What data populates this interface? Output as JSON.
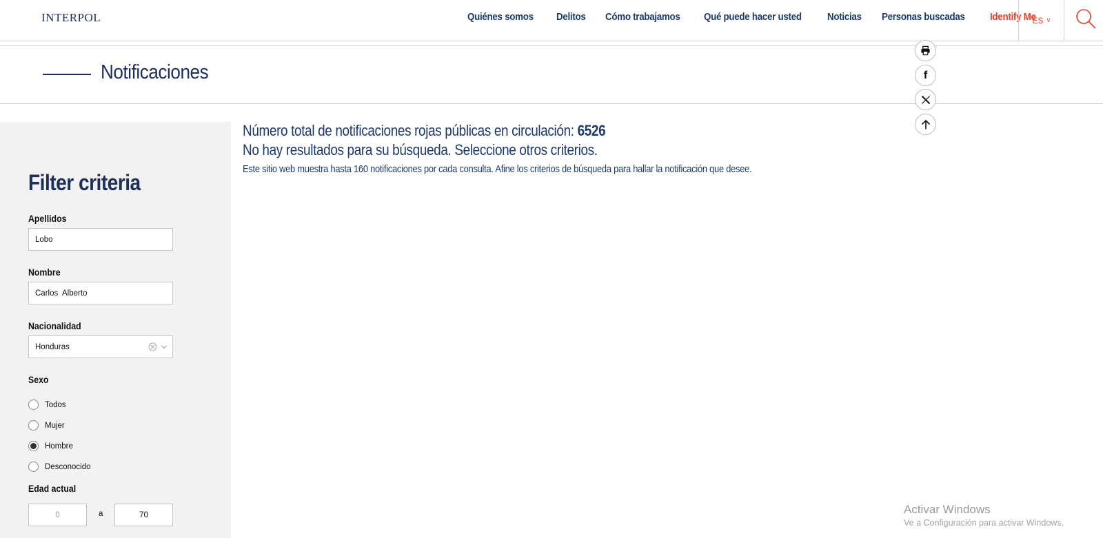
{
  "header": {
    "logo": "INTERPOL",
    "nav": [
      "Quiénes somos",
      "Delitos",
      "Cómo trabajamos",
      "Qué puede hacer usted",
      "Noticias",
      "Personas buscadas",
      "Identify Me"
    ],
    "language": "ES",
    "language_chevron": "v",
    "search_icon": "search-icon"
  },
  "page": {
    "title": "Notificaciones"
  },
  "share": {
    "icons": [
      "print-icon",
      "facebook-icon",
      "x-icon",
      "arrow-up-icon"
    ],
    "facebook_glyph": "f"
  },
  "filter": {
    "title": "Filter criteria",
    "apellidos_label": "Apellidos",
    "apellidos_value": "Lobo",
    "nombre_label": "Nombre",
    "nombre_value": "Carlos  Alberto",
    "nacionalidad_label": "Nacionalidad",
    "nacionalidad_value": "Honduras",
    "sexo_label": "Sexo",
    "sexo_options": [
      "Todos",
      "Mujer",
      "Hombre",
      "Desconocido"
    ],
    "sexo_selected": "Hombre",
    "edad_label": "Edad actual",
    "edad_min_placeholder": "0",
    "edad_separator": "a",
    "edad_max_value": "70"
  },
  "results": {
    "total_label": "Número total de notificaciones rojas públicas en circulación: ",
    "total_value": "6526",
    "no_results": "No hay resultados para su búsqueda. Seleccione otros criterios.",
    "note": "Este sitio web muestra hasta 160 notificaciones por cada consulta. Afine los criterios de búsqueda para hallar la notificación que desee."
  },
  "watermark": {
    "title": "Activar Windows",
    "subtitle": "Ve a Configuración para activar Windows."
  },
  "colors": {
    "primary": "#1e3a6a",
    "accent": "#e8412c",
    "sidebar_bg": "#f2f2f2"
  }
}
